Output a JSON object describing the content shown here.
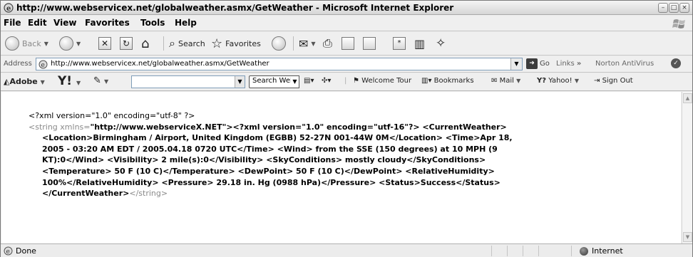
{
  "window": {
    "title": "http://www.webservicex.net/globalweather.asmx/GetWeather - Microsoft Internet Explorer",
    "controls": [
      "minimize-icon",
      "maximize-icon",
      "close-icon"
    ]
  },
  "menu": [
    "File",
    "Edit",
    "View",
    "Favorites",
    "Tools",
    "Help"
  ],
  "toolbar": {
    "back": "Back",
    "search": "Search",
    "favorites": "Favorites"
  },
  "address": {
    "label": "Address",
    "url": "http://www.webservicex.net/globalweather.asmx/GetWeather",
    "go": "Go",
    "links": "Links",
    "links_chevron": "»",
    "norton": "Norton AntiVirus"
  },
  "yahoo_bar": {
    "adobe": "Adobe",
    "search_value": "",
    "search_web": "Search Web",
    "welcome_tour": "Welcome Tour",
    "bookmarks": "Bookmarks",
    "mail": "Mail",
    "yahoo": "Yahoo!",
    "sign_out": "Sign Out"
  },
  "content": {
    "line1": "<?xml version=\"1.0\" encoding=\"utf-8\" ?>",
    "line2_prefix": "<string xmlns=",
    "line2_ns": "\"http://www.webserviceX.NET\"",
    "line2_rest": "><?xml version=\"1.0\" encoding=\"utf-16\"?> <CurrentWeather>",
    "line3": "<Location>Birmingham / Airport, United Kingdom (EGBB) 52-27N 001-44W 0M</Location> <Time>Apr 18,",
    "line4": "2005 - 03:20 AM EDT / 2005.04.18 0720 UTC</Time> <Wind> from the SSE (150 degrees) at 10 MPH (9",
    "line5": "KT):0</Wind> <Visibility> 2 mile(s):0</Visibility> <SkyConditions> mostly cloudy</SkyConditions>",
    "line6": "<Temperature> 50 F (10 C)</Temperature> <DewPoint> 50 F (10 C)</DewPoint> <RelativeHumidity>",
    "line7": "100%</RelativeHumidity> <Pressure> 29.18 in. Hg (0988 hPa)</Pressure> <Status>Success</Status>",
    "line8_a": "</CurrentWeather>",
    "line8_b": "</string>"
  },
  "status": {
    "text": "Done",
    "zone": "Internet"
  }
}
